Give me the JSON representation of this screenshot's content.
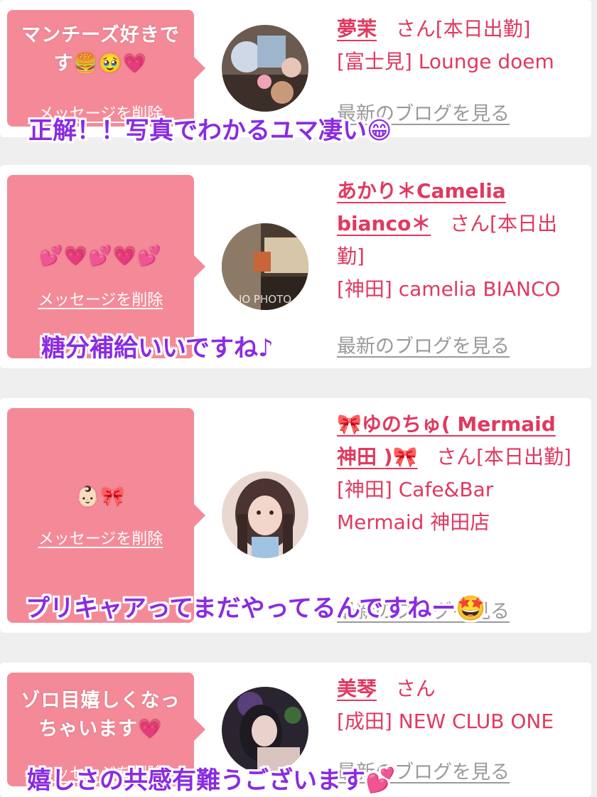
{
  "messages": [
    {
      "bubble_text": "マンチーズ好きです🍔🥹💗",
      "delete_label": "メッセージを削除",
      "name": "夢茉",
      "suffix": "さん[本日出勤]",
      "location": "[富士見] Lounge doem",
      "blog_label": "最新のブログを見る",
      "caption": "正解！！写真でわかるユマ凄い😁"
    },
    {
      "bubble_text": "💕💗💕💗💕",
      "delete_label": "メッセージを削除",
      "name": "あかり＊Camelia bianco＊",
      "suffix": "さん[本日出勤]",
      "location": "[神田] camelia BIANCO",
      "blog_label": "最新のブログを見る",
      "caption": "糖分補給いいですね♪"
    },
    {
      "bubble_text": "👶🏻🎀",
      "delete_label": "メッセージを削除",
      "name": "🎀ゆのちゅ( Mermaid 神田 )🎀",
      "suffix": "さん[本日出勤]",
      "location": "[神田] Cafe&Bar Mermaid 神田店",
      "blog_label": "最新のブログを見る",
      "caption": "プリキャアってまだやってるんですねー🤩"
    },
    {
      "bubble_text": "ゾロ目嬉しくなっちゃいます💗",
      "delete_label": "メッセージを削除",
      "name": "美琴",
      "suffix": "さん",
      "location": "[成田] NEW CLUB ONE",
      "blog_label": "最新のブログを見る",
      "caption": "嬉しさの共感有難うございます💕"
    }
  ],
  "avatar_overlay_text": "IO PHOTO"
}
